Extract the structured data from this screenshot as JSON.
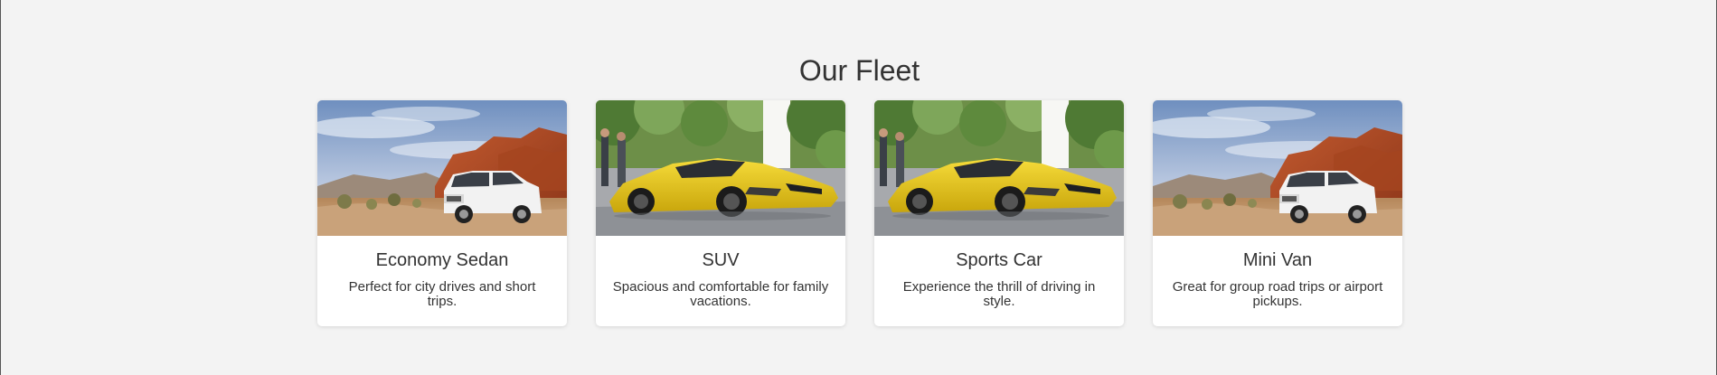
{
  "fleet": {
    "title": "Our Fleet",
    "cards": [
      {
        "image": "white-suv-desert-photo",
        "title": "Economy Sedan",
        "description": "Perfect for city drives and short trips."
      },
      {
        "image": "yellow-sports-car-photo",
        "title": "SUV",
        "description": "Spacious and comfortable for family vacations."
      },
      {
        "image": "yellow-sports-car-photo",
        "title": "Sports Car",
        "description": "Experience the thrill of driving in style."
      },
      {
        "image": "white-suv-desert-photo",
        "title": "Mini Van",
        "description": "Great for group road trips or airport pickups."
      }
    ]
  },
  "colors": {
    "page_background": "#f3f3f3",
    "card_background": "#ffffff",
    "text": "#333333",
    "car_yellow": "#e8c416",
    "car_white": "#f2f2f2"
  }
}
